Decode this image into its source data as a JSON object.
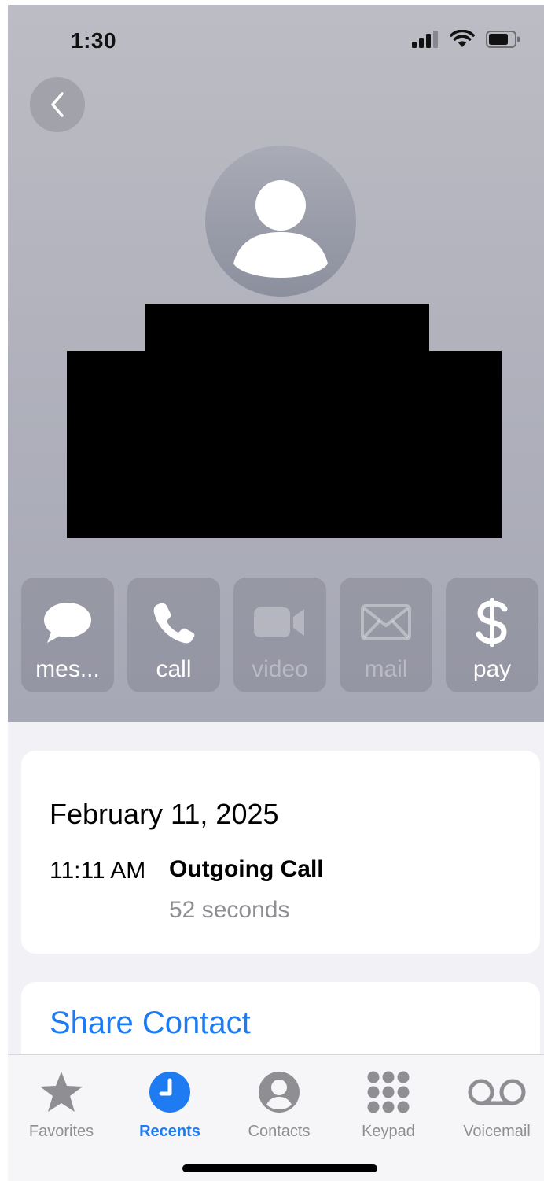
{
  "status_bar": {
    "time": "1:30"
  },
  "header": {
    "actions": [
      {
        "id": "message",
        "label": "mes...",
        "icon": "message-bubble-icon",
        "enabled": true
      },
      {
        "id": "call",
        "label": "call",
        "icon": "phone-icon",
        "enabled": true
      },
      {
        "id": "video",
        "label": "video",
        "icon": "video-camera-icon",
        "enabled": false
      },
      {
        "id": "mail",
        "label": "mail",
        "icon": "envelope-icon",
        "enabled": false
      },
      {
        "id": "pay",
        "label": "pay",
        "icon": "dollar-icon",
        "enabled": true
      }
    ]
  },
  "calls": {
    "date": "February 11, 2025",
    "time": "11:11 AM",
    "type": "Outgoing Call",
    "duration": "52 seconds"
  },
  "share": {
    "label": "Share Contact"
  },
  "tab_bar": {
    "tabs": [
      {
        "label": "Favorites",
        "icon": "star-icon",
        "active": false
      },
      {
        "label": "Recents",
        "icon": "clock-icon",
        "active": true
      },
      {
        "label": "Contacts",
        "icon": "person-circle-icon",
        "active": false
      },
      {
        "label": "Keypad",
        "icon": "keypad-icon",
        "active": false
      },
      {
        "label": "Voicemail",
        "icon": "voicemail-icon",
        "active": false
      }
    ]
  },
  "colors": {
    "accent": "#1f7bf2",
    "header_bg": "#b1b2bd",
    "page_bg": "#f2f2f6"
  }
}
